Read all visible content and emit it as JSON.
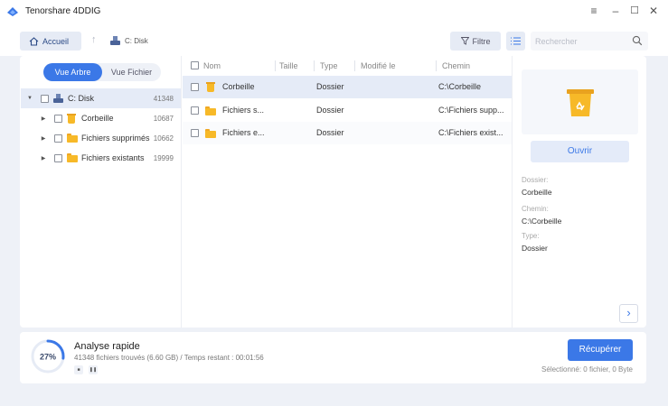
{
  "window": {
    "title": "Tenorshare 4DDIG",
    "controls": [
      "menu-icon",
      "minimize-icon",
      "maximize-icon",
      "close-icon"
    ]
  },
  "toolbar": {
    "home_label": "Accueil",
    "breadcrumb_disk": "C: Disk",
    "filter_label": "Filtre",
    "search_placeholder": "Rechercher"
  },
  "view_toggle": {
    "tree_label": "Vue Arbre",
    "file_label": "Vue Fichier",
    "active": "tree"
  },
  "tree": [
    {
      "label": "C: Disk",
      "count": "41348",
      "icon": "disk-icon",
      "selected": true
    },
    {
      "label": "Corbeille",
      "count": "10687",
      "icon": "recycle-bin-icon"
    },
    {
      "label": "Fichiers supprimés",
      "count": "10662",
      "icon": "folder-icon"
    },
    {
      "label": "Fichiers existants",
      "count": "19999",
      "icon": "folder-icon"
    }
  ],
  "table": {
    "columns": [
      "Nom",
      "Taille",
      "Type",
      "Modifié le",
      "Chemin"
    ],
    "rows": [
      {
        "name": "Corbeille",
        "size": "",
        "type": "Dossier",
        "modified": "",
        "path": "C:\\Corbeille",
        "icon": "recycle-bin-icon",
        "selected": true
      },
      {
        "name": "Fichiers s...",
        "size": "",
        "type": "Dossier",
        "modified": "",
        "path": "C:\\Fichiers supp...",
        "icon": "folder-icon"
      },
      {
        "name": "Fichiers e...",
        "size": "",
        "type": "Dossier",
        "modified": "",
        "path": "C:\\Fichiers exist...",
        "icon": "folder-icon"
      }
    ]
  },
  "preview": {
    "open_label": "Ouvrir",
    "folder_label": "Dossier:",
    "folder_value": "Corbeille",
    "path_label": "Chemin:",
    "path_value": "C:\\Corbeille",
    "type_label": "Type:",
    "type_value": "Dossier"
  },
  "scan": {
    "percent": "27%",
    "progress": 0.27,
    "title": "Analyse rapide",
    "info": "41348 fichiers trouvés (6.60 GB) /   Temps restant : 00:01:56",
    "recover_label": "Récupérer",
    "selection": "Sélectionné: 0 fichier, 0 Byte"
  },
  "colors": {
    "accent": "#3b78e7",
    "folder": "#f7b928",
    "selection": "#e5ebf7"
  }
}
